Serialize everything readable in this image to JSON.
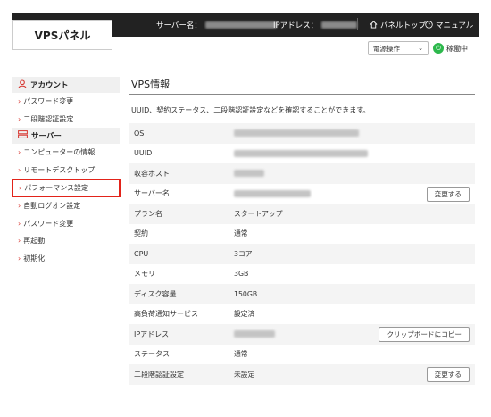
{
  "header": {
    "logo": "VPSパネル",
    "server_name_label": "サーバー名：",
    "ip_label": "IPアドレス：",
    "home_link": "パネルトップ",
    "manual_link": "マニュアル",
    "home_icon": "home-icon",
    "help_icon": "help-circle-icon"
  },
  "toolbar": {
    "power_select": "電源操作",
    "status_label": "稼働中",
    "status_color": "#2db84c"
  },
  "sidebar": {
    "account": {
      "heading": "アカウント",
      "items": [
        {
          "label": "パスワード変更"
        },
        {
          "label": "二段階認証設定"
        }
      ]
    },
    "server": {
      "heading": "サーバー",
      "items": [
        {
          "label": "コンピューターの情報"
        },
        {
          "label": "リモートデスクトップ"
        },
        {
          "label": "パフォーマンス設定"
        },
        {
          "label": "自動ログオン設定"
        },
        {
          "label": "パスワード変更"
        },
        {
          "label": "再起動"
        },
        {
          "label": "初期化"
        }
      ]
    },
    "accent_color": "#d7352f",
    "highlight_color": "#e2231a"
  },
  "main": {
    "title": "VPS情報",
    "description": "UUID、契約ステータス、二段階認証設定などを確認することができます。",
    "rows": [
      {
        "label": "OS",
        "value": ""
      },
      {
        "label": "UUID",
        "value": ""
      },
      {
        "label": "収容ホスト",
        "value": ""
      },
      {
        "label": "サーバー名",
        "value": "",
        "button": "変更する"
      },
      {
        "label": "プラン名",
        "value": "スタートアップ"
      },
      {
        "label": "契約",
        "value": "通常"
      },
      {
        "label": "CPU",
        "value": "3コア"
      },
      {
        "label": "メモリ",
        "value": "3GB"
      },
      {
        "label": "ディスク容量",
        "value": "150GB"
      },
      {
        "label": "高負荷通知サービス",
        "value": "設定済"
      },
      {
        "label": "IPアドレス",
        "value": "",
        "button": "クリップボードにコピー"
      },
      {
        "label": "ステータス",
        "value": "通常"
      },
      {
        "label": "二段階認証設定",
        "value": "未設定",
        "button": "変更する"
      }
    ]
  }
}
